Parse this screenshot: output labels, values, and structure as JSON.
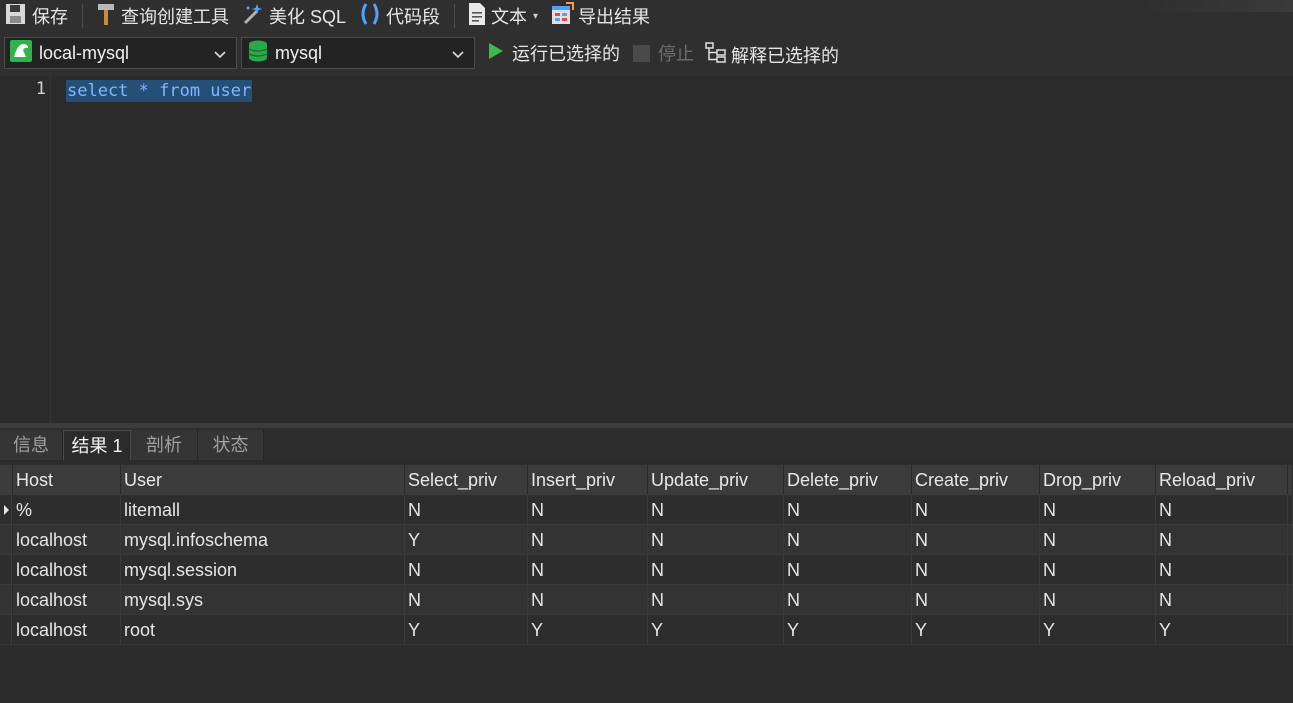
{
  "toolbar": {
    "save": "保存",
    "query_builder": "查询创建工具",
    "beautify": "美化 SQL",
    "snippet": "代码段",
    "text": "文本",
    "export": "导出结果"
  },
  "connection": {
    "selected": "local-mysql",
    "icon": "mysql-connection-icon"
  },
  "database": {
    "selected": "mysql",
    "icon": "database-icon"
  },
  "actions": {
    "run_selected": "运行已选择的",
    "stop": "停止",
    "explain_selected": "解释已选择的"
  },
  "editor": {
    "line_number": "1",
    "code": "select * from user"
  },
  "result_tabs": [
    {
      "label": "信息",
      "active": false
    },
    {
      "label": "结果 1",
      "active": true
    },
    {
      "label": "剖析",
      "active": false
    },
    {
      "label": "状态",
      "active": false
    }
  ],
  "grid": {
    "columns": [
      "Host",
      "User",
      "Select_priv",
      "Insert_priv",
      "Update_priv",
      "Delete_priv",
      "Create_priv",
      "Drop_priv",
      "Reload_priv"
    ],
    "rows": [
      [
        "%",
        "litemall",
        "N",
        "N",
        "N",
        "N",
        "N",
        "N",
        "N"
      ],
      [
        "localhost",
        "mysql.infoschema",
        "Y",
        "N",
        "N",
        "N",
        "N",
        "N",
        "N"
      ],
      [
        "localhost",
        "mysql.session",
        "N",
        "N",
        "N",
        "N",
        "N",
        "N",
        "N"
      ],
      [
        "localhost",
        "mysql.sys",
        "N",
        "N",
        "N",
        "N",
        "N",
        "N",
        "N"
      ],
      [
        "localhost",
        "root",
        "Y",
        "Y",
        "Y",
        "Y",
        "Y",
        "Y",
        "Y"
      ]
    ],
    "current_row": 0
  },
  "colors": {
    "background": "#2b2b2b",
    "selection": "#264f78",
    "run_green": "#3fb94a",
    "db_green": "#2aa84a"
  }
}
